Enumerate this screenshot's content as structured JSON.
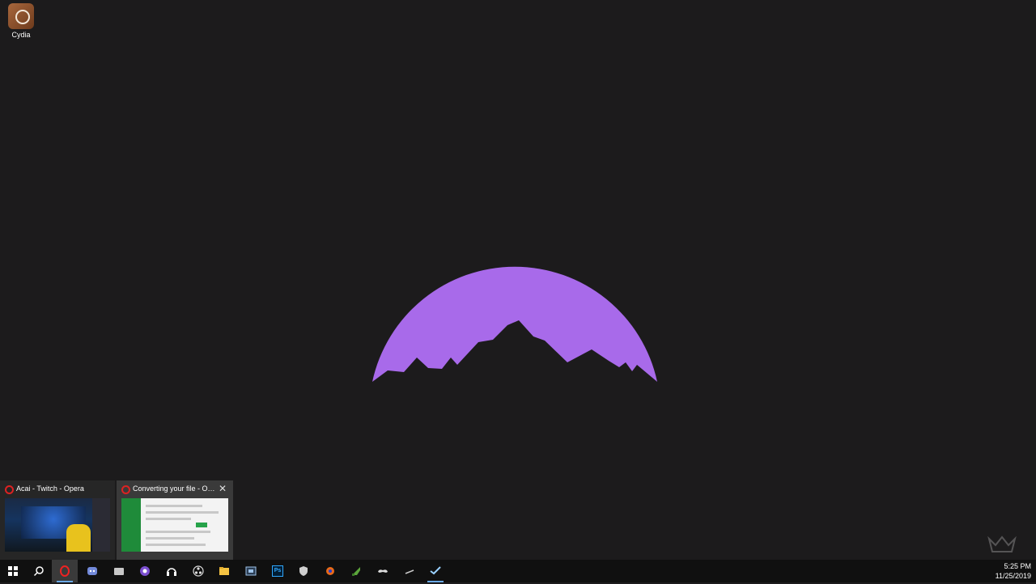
{
  "desktop": {
    "icons": [
      {
        "label": "Cydia"
      }
    ],
    "wallpaper": {
      "accent_color": "#a86aea",
      "background_color": "#1c1b1c"
    }
  },
  "previews": [
    {
      "title": "Acai - Twitch - Opera",
      "icon": "opera-icon"
    },
    {
      "title": "Converting your file - Op...",
      "icon": "opera-icon",
      "close_glyph": "✕"
    }
  ],
  "taskbar": {
    "items": [
      {
        "name": "start-button",
        "icon": "windows-logo-icon"
      },
      {
        "name": "search-button",
        "icon": "search-icon"
      },
      {
        "name": "opera",
        "icon": "opera-icon",
        "state": "active"
      },
      {
        "name": "discord",
        "icon": "discord-icon"
      },
      {
        "name": "files",
        "icon": "folder-icon"
      },
      {
        "name": "app-5",
        "icon": "purple-circle-icon"
      },
      {
        "name": "headphones",
        "icon": "headset-icon"
      },
      {
        "name": "obs",
        "icon": "obs-icon"
      },
      {
        "name": "file-explorer",
        "icon": "file-explorer-icon"
      },
      {
        "name": "video-editor",
        "icon": "film-icon"
      },
      {
        "name": "photoshop",
        "icon": "photoshop-icon",
        "text": "Ps"
      },
      {
        "name": "app-12",
        "icon": "shield-icon"
      },
      {
        "name": "app-13",
        "icon": "orange-game-icon"
      },
      {
        "name": "minecraft",
        "icon": "minecraft-icon"
      },
      {
        "name": "app-15",
        "icon": "controller-icon"
      },
      {
        "name": "app-16",
        "icon": "pen-icon"
      },
      {
        "name": "steam",
        "icon": "steam-icon",
        "state": "running"
      }
    ],
    "clock": {
      "time": "5:25 PM",
      "date": "11/25/2019"
    }
  }
}
